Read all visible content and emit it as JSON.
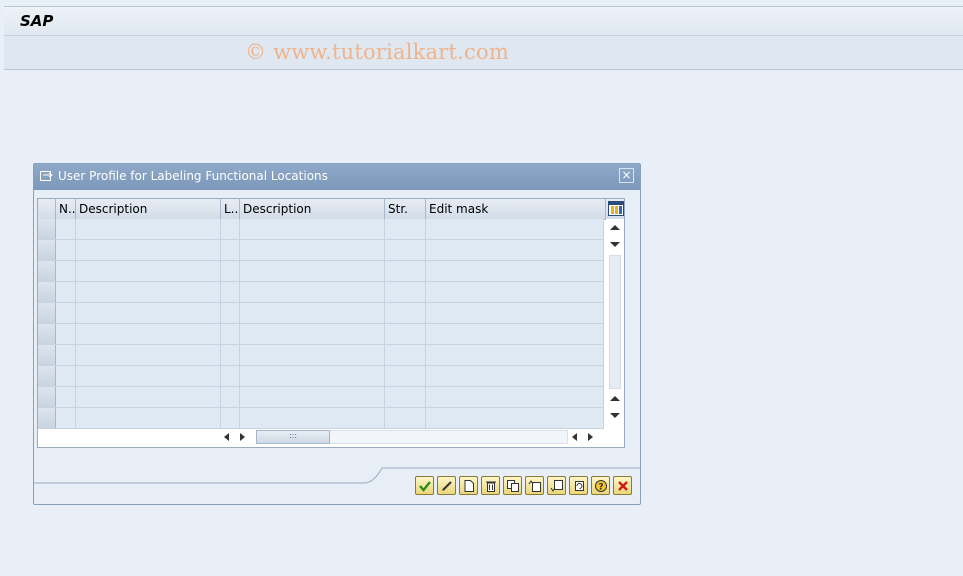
{
  "app": {
    "title": "SAP",
    "watermark": "© www.tutorialkart.com"
  },
  "dialog": {
    "title": "User Profile for Labeling Functional Locations",
    "close_label": "×",
    "table": {
      "columns": [
        "N..",
        "Description",
        "L..",
        "Description",
        "Str.",
        "Edit mask"
      ],
      "row_count": 10,
      "hthumb_glyph": ":::"
    },
    "buttons": [
      {
        "name": "continue-button",
        "icon": "checkmark-icon"
      },
      {
        "name": "change-button",
        "icon": "pencil-icon"
      },
      {
        "name": "new-entry-button",
        "icon": "new-document-icon"
      },
      {
        "name": "delete-button",
        "icon": "trash-icon"
      },
      {
        "name": "copy-button",
        "icon": "copy-icon"
      },
      {
        "name": "insert-button",
        "icon": "insert-icon"
      },
      {
        "name": "move-down-button",
        "icon": "move-down-icon"
      },
      {
        "name": "refresh-button",
        "icon": "refresh-icon"
      },
      {
        "name": "help-button",
        "icon": "help-icon"
      },
      {
        "name": "cancel-button",
        "icon": "cancel-icon"
      }
    ]
  },
  "colors": {
    "header_blue": "#7b97ba",
    "button_yellow": "#ead67a",
    "watermark": "#f0b48c"
  }
}
